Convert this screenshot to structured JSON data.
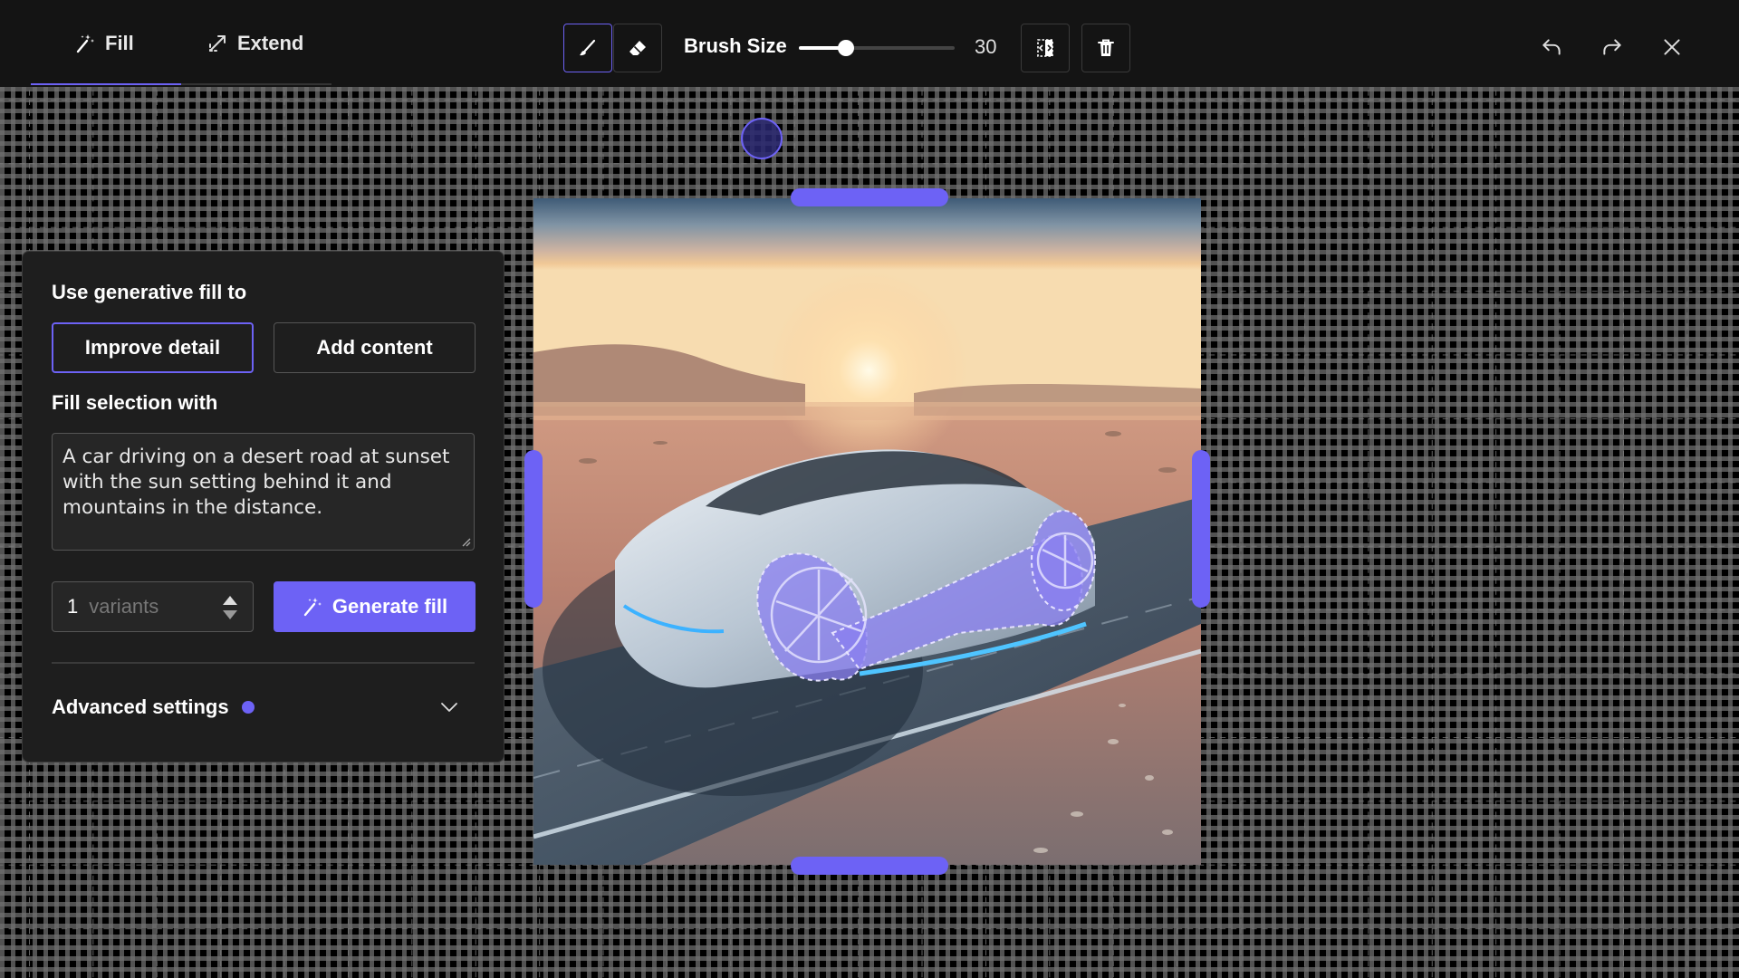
{
  "toolbar": {
    "tabs": [
      {
        "label": "Fill",
        "icon": "magic-wand-icon",
        "active": true
      },
      {
        "label": "Extend",
        "icon": "expand-arrows-icon",
        "active": false
      }
    ],
    "tools": [
      {
        "icon": "brush-icon",
        "active": true
      },
      {
        "icon": "eraser-icon",
        "active": false
      }
    ],
    "brush_label": "Brush Size",
    "brush_value": "30",
    "brush_fraction": 0.3,
    "actions": [
      {
        "icon": "invert-selection-icon"
      },
      {
        "icon": "trash-icon"
      }
    ],
    "window": [
      {
        "icon": "undo-icon"
      },
      {
        "icon": "redo-icon"
      },
      {
        "icon": "close-icon"
      }
    ]
  },
  "panel": {
    "heading": "Use generative fill to",
    "options": [
      {
        "label": "Improve detail",
        "selected": true
      },
      {
        "label": "Add content",
        "selected": false
      }
    ],
    "fill_heading": "Fill selection with",
    "prompt": "A car driving on a desert road at sunset with the sun setting behind it and mountains in the distance.",
    "variants_count": "1",
    "variants_unit": "variants",
    "generate_label": "Generate fill",
    "advanced_label": "Advanced settings"
  },
  "colors": {
    "accent": "#6d62f5",
    "toolbar_bg": "#141414",
    "panel_bg": "#1e1e1e"
  }
}
